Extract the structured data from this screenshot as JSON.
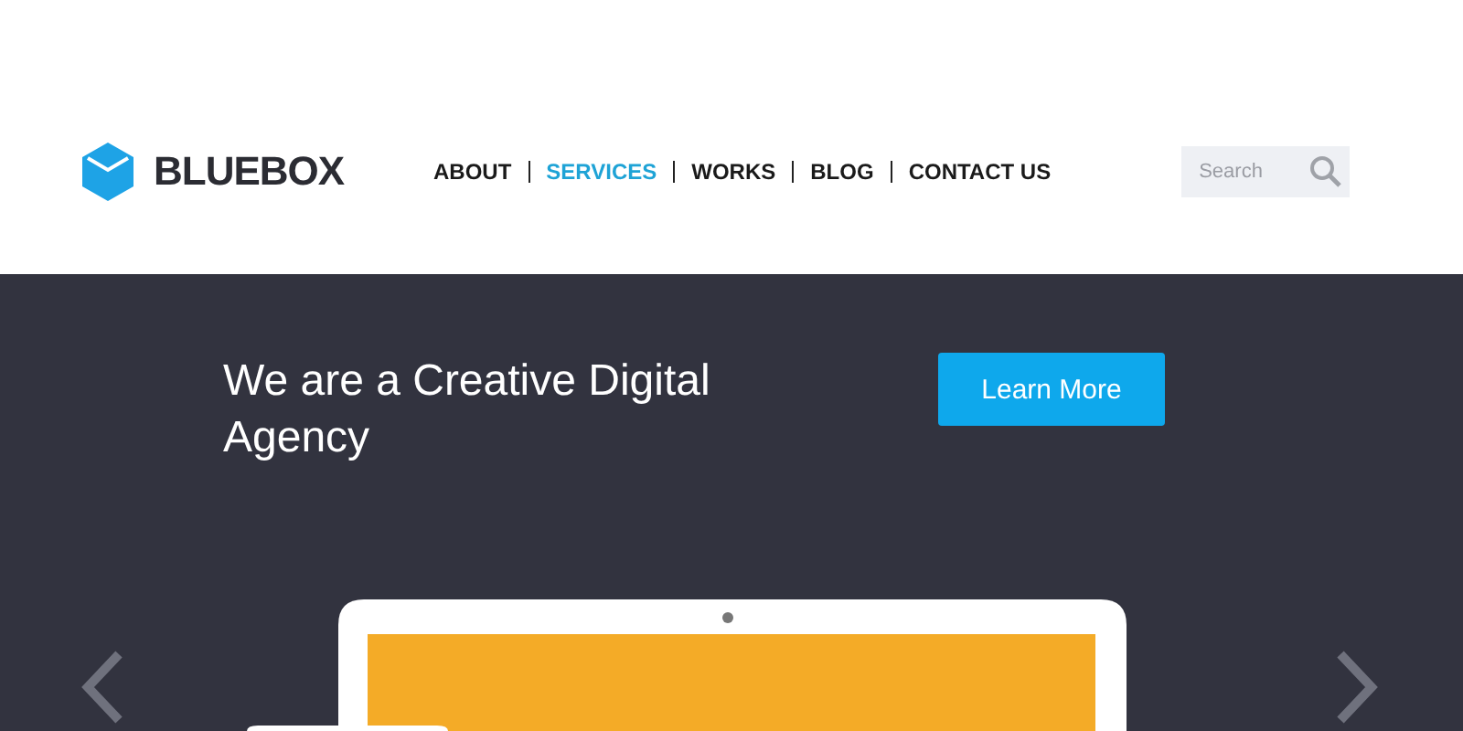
{
  "logo": {
    "text": "BLUEBOX"
  },
  "nav": [
    {
      "label": "ABOUT",
      "selected": false
    },
    {
      "label": "SERVICES",
      "selected": true
    },
    {
      "label": "WORKS",
      "selected": false
    },
    {
      "label": "BLOG",
      "selected": false
    },
    {
      "label": "CONTACT US",
      "selected": false
    }
  ],
  "search": {
    "placeholder": "Search"
  },
  "hero": {
    "headline": "We are a Creative Digital Agency",
    "button": "Learn More"
  }
}
